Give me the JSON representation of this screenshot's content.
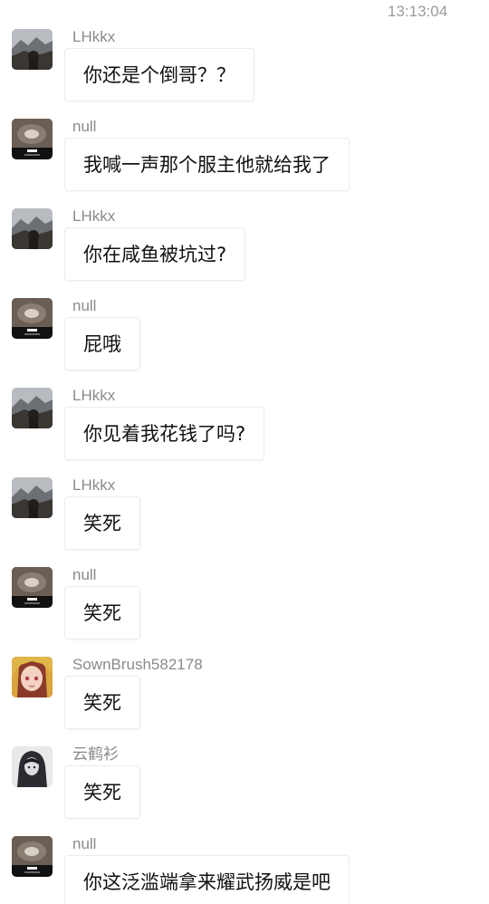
{
  "timestamp": "13:13:04",
  "messages": [
    {
      "sender": "LHkkx",
      "avatar": "mountain-avatar-icon",
      "text": "你还是个倒哥？？"
    },
    {
      "sender": "null",
      "avatar": "stone-ring-avatar-icon",
      "text": "我喊一声那个服主他就给我了"
    },
    {
      "sender": "LHkkx",
      "avatar": "mountain-avatar-icon",
      "text": "你在咸鱼被坑过?"
    },
    {
      "sender": "null",
      "avatar": "stone-ring-avatar-icon",
      "text": "屁哦"
    },
    {
      "sender": "LHkkx",
      "avatar": "mountain-avatar-icon",
      "text": "你见着我花钱了吗?"
    },
    {
      "sender": "LHkkx",
      "avatar": "mountain-avatar-icon",
      "text": "笑死"
    },
    {
      "sender": "null",
      "avatar": "stone-ring-avatar-icon",
      "text": "笑死"
    },
    {
      "sender": "SownBrush582178",
      "avatar": "anime-girl-avatar-icon",
      "text": "笑死"
    },
    {
      "sender": "云鹤衫",
      "avatar": "hooded-figure-avatar-icon",
      "text": "笑死"
    },
    {
      "sender": "null",
      "avatar": "stone-ring-avatar-icon",
      "text": "你这泛滥端拿来耀武扬威是吧"
    }
  ]
}
